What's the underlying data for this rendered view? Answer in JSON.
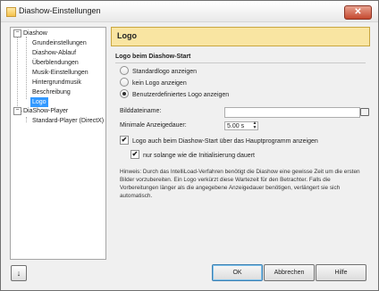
{
  "window": {
    "title": "Diashow-Einstellungen",
    "close_glyph": "✕"
  },
  "tree": {
    "group1": "Diashow",
    "group1_items": [
      "Grundeinstellungen",
      "Diashow-Ablauf",
      "Überblendungen",
      "Musik-Einstellungen",
      "Hintergrundmusik",
      "Beschreibung",
      "Logo"
    ],
    "group2": "DiaShow-Player",
    "group2_items": [
      "Standard-Player (DirectX)"
    ],
    "toggle_glyph": "−"
  },
  "header": {
    "title": "Logo"
  },
  "section": {
    "title": "Logo beim Diashow-Start"
  },
  "radios": [
    "Standardlogo anzeigen",
    "kein Logo anzeigen",
    "Benutzerdefiniertes Logo anzeigen"
  ],
  "fields": {
    "filename_label": "Bilddateiname:",
    "filename_value": "",
    "duration_label": "Minimale Anzeigedauer:",
    "duration_value": "5.00 s",
    "spin_up": "▲",
    "spin_down": "▼"
  },
  "checks": {
    "mark": "✔",
    "also_main": "Logo auch beim Diashow-Start über das Hauptprogramm anzeigen",
    "only_init": "nur solange wie die Initialisierung dauert"
  },
  "hint": "Hinweis: Durch das IntelliLoad-Verfahren benötigt die Diashow eine gewisse Zeit um die ersten Bilder vorzubereiten. Ein Logo verkürzt diese Wartezeit für den Betrachter. Falls die Vorbereitungen länger als die angegebene Anzeigedauer benötigen, verlängert sie sich automatisch.",
  "footer": {
    "help_icon_glyph": "↓",
    "ok": "OK",
    "cancel": "Abbrechen",
    "help": "Hilfe"
  },
  "icons": {
    "close": "close-icon",
    "folder": "folder-icon",
    "help": "arrow-down-icon"
  }
}
